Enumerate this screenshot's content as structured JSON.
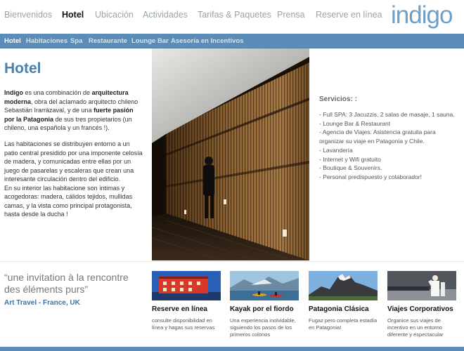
{
  "topnav": {
    "items": [
      {
        "label": "Bienvenidos",
        "active": false
      },
      {
        "label": "Hotel",
        "active": true
      },
      {
        "label": "Ubicación",
        "active": false
      },
      {
        "label": "Actividades",
        "active": false
      },
      {
        "label": "Tarifas & Paquetes",
        "active": false
      },
      {
        "label": "Prensa",
        "active": false
      },
      {
        "label": "Reserve en línea",
        "active": false
      }
    ],
    "logo": "indigo"
  },
  "subnav": {
    "items": [
      {
        "label": "Hotel",
        "active": true
      },
      {
        "label": "Habitaciones",
        "active": false
      },
      {
        "label": "Spa",
        "active": false
      },
      {
        "label": "Restaurante",
        "active": false
      },
      {
        "label": "Lounge Bar",
        "active": false
      },
      {
        "label": "Asesoría en Incentivos",
        "active": false
      }
    ]
  },
  "main": {
    "title": "Hotel",
    "para1": {
      "b1": "Indigo",
      "t1": " es una combinación de ",
      "b2": "arquitectura moderna",
      "t2": ", obra del aclamado arquitecto chileno Sebastián Irarrázaval, y de una ",
      "b3": "fuerte pasión por la Patagonia",
      "t3": " de sus tres propietarios (un chileno, una española y un francés !)."
    },
    "para2": "Las habitaciones se distribuyen entorno a un patio central presidido por una imponente celosía de madera, y comunicadas entre ellas por un juego de pasarelas y escaleras que crean una interesante circulación dentro del edificio.",
    "para3": "En su interior las habitacione son íntimas y acogedoras: madera, cálidos tejidos, mullidas camas, y la vista como principal protagonista, hasta desde la ducha !"
  },
  "services": {
    "title": "Servicios: :",
    "items": [
      "- Full SPA: 3 Jacuzzis, 2 salas de masaje, 1 sauna.",
      "- Lounge Bar & Restaurant",
      "- Agencia de Viajes: Asistencia gratuita para organizar su viaje en Patagonia y Chile.",
      "- Lavandería",
      "- Internet y Wifi gratuito",
      "- Boutique & Souvenirs.",
      "- Personal predispuesto y colaborador!"
    ]
  },
  "quote": {
    "text": "“une invitation à la rencontre des éléments purs”",
    "source": "Art Travel - France, UK"
  },
  "features": [
    {
      "title": "Reserve en línea",
      "desc": "consulte disponibilidad en línea y hagas sus reservas"
    },
    {
      "title": "Kayak por el fiordo",
      "desc": "Una experiencia inolvidable, siguiendo los pasos de los primeros colonos"
    },
    {
      "title": "Patagonia Clásica",
      "desc": "Fugaz pero completa estadía en Patagonia!"
    },
    {
      "title": "Viajes Corporativos",
      "desc": "Organice sus viajes de incentivo en un entorno diferente y espectacular"
    }
  ],
  "colors": {
    "brand": "#5b8db8",
    "title": "#4a80ad",
    "link": "#3a73a8"
  }
}
